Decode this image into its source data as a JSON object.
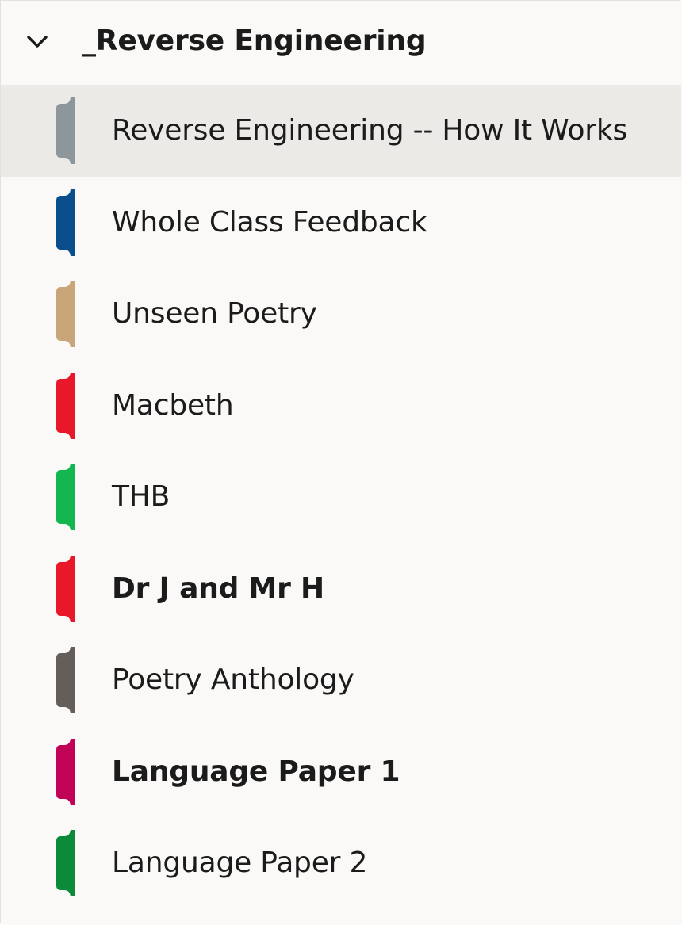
{
  "notebook": {
    "group": {
      "title": "_Reverse Engineering",
      "expanded": true,
      "chevron_icon": "chevron-down-icon"
    },
    "sections": [
      {
        "label": "Reverse Engineering -- How It Works",
        "color": "#8d979b",
        "bold": false,
        "selected": true
      },
      {
        "label": "Whole Class Feedback",
        "color": "#0a4f8c",
        "bold": false,
        "selected": false
      },
      {
        "label": "Unseen Poetry",
        "color": "#c8a679",
        "bold": false,
        "selected": false
      },
      {
        "label": "Macbeth",
        "color": "#e8182a",
        "bold": false,
        "selected": false
      },
      {
        "label": "THB",
        "color": "#12b84f",
        "bold": false,
        "selected": false
      },
      {
        "label": "Dr J and Mr H",
        "color": "#e8182a",
        "bold": true,
        "selected": false
      },
      {
        "label": "Poetry Anthology",
        "color": "#635e5a",
        "bold": false,
        "selected": false
      },
      {
        "label": "Language Paper 1",
        "color": "#c00357",
        "bold": true,
        "selected": false
      },
      {
        "label": "Language Paper 2",
        "color": "#0b8a3a",
        "bold": false,
        "selected": false
      }
    ]
  }
}
